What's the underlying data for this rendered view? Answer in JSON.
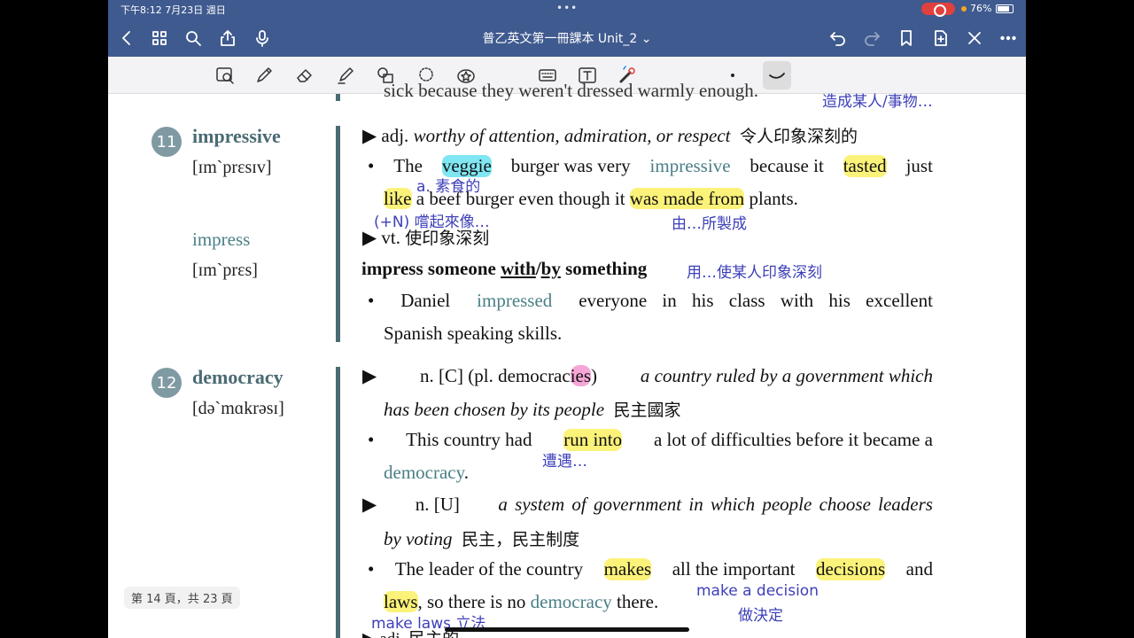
{
  "status": {
    "time": "下午8:12 7月23日 週日",
    "battery": "76%",
    "dots": "•••"
  },
  "nav": {
    "title": "普乙英文第一冊課本 Unit_2 ⌄"
  },
  "doc": {
    "top_cut": "sick because they weren't dressed warmly enough.",
    "top_note": "造成某人/事物…",
    "e11": {
      "num": "11",
      "word": "impressive",
      "phon": "[ɪm`prɛsɪv]",
      "marker": "▶",
      "bullet": "•",
      "pos1": "adj.",
      "def1": "worthy of attention, admiration, or respect",
      "zh1": "令人印象深刻的",
      "ex1_a": "The",
      "ex1_veggie": "veggie",
      "ex1_b": "burger was very",
      "ex1_kw": "impressive",
      "ex1_c": "because it",
      "ex1_tasted": "tasted",
      "ex1_d": "just",
      "ex1_like": "like",
      "ex1_e": "a beef burger even though it",
      "ex1_made": "was made from",
      "ex1_f": "plants.",
      "n_veggie": "a. 素食的",
      "n_like": "(+N) 嚐起來像…",
      "n_made": "由…所製成",
      "word2": "impress",
      "phon2": "[ɪm`prɛs]",
      "pos2": "vt.",
      "zh2": "使印象深刻",
      "phrase_a": "impress someone",
      "phrase_with": "with",
      "phrase_slash": "/",
      "phrase_by": "by",
      "phrase_b": "something",
      "phrase_zh": "用…使某人印象深刻",
      "ex2_a": "Daniel",
      "ex2_kw": "impressed",
      "ex2_b": "everyone in his class with his excellent",
      "ex2_c": "Spanish speaking skills."
    },
    "e12": {
      "num": "12",
      "word": "democracy",
      "phon": "[də`mɑkrəsɪ]",
      "pos1a": "n. [C] (pl. democrac",
      "pos1_hl": "ies",
      "pos1b": ")",
      "def1a": "a country ruled by a government which",
      "def1b": "has been chosen by its people",
      "zh1": "民主國家",
      "ex1_a": "This country had",
      "ex1_run": "run into",
      "ex1_b": "a lot of difficulties before it became a",
      "ex1_kw": "democracy",
      "ex1_dot": ".",
      "n_run": "遭遇…",
      "pos2": "n. [U]",
      "def2a": "a system of government in which people choose leaders",
      "def2b": "by voting",
      "zh2": "民主，民主制度",
      "ex2_a": "The leader of the country",
      "ex2_makes": "makes",
      "ex2_b": "all the important",
      "ex2_dec": "decisions",
      "ex2_c": "and",
      "ex2_laws": "laws",
      "ex2_d": ", so there is no",
      "ex2_kw": "democracy",
      "ex2_e": "there.",
      "n_decision1": "make a decision",
      "n_decision2": "做決定",
      "n_laws": "make laws 立法",
      "bottom_cut": "▶ adj. 民主的"
    },
    "page_indicator": "第 14 頁，共 23 頁"
  }
}
